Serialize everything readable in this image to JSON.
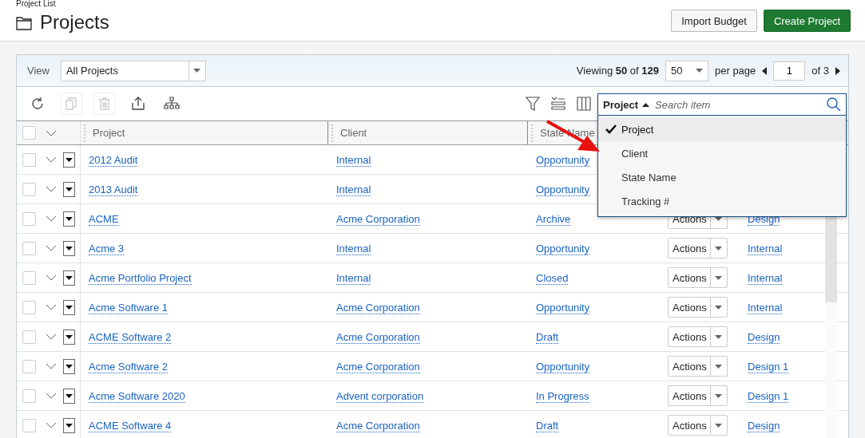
{
  "breadcrumb": "Project List",
  "title": "Projects",
  "header_buttons": [
    {
      "label": "Import Budget",
      "kind": "secondary"
    },
    {
      "label": "Create Project",
      "kind": "primary"
    }
  ],
  "view": {
    "label": "View",
    "value": "All Projects"
  },
  "pagination": {
    "summary": "Viewing **50** of **129**",
    "per_page": "50",
    "per_page_label": "per page",
    "page": "1",
    "of_pages": "of 3"
  },
  "toolbar": [
    {
      "kind": "refresh",
      "disabled": false
    },
    {
      "kind": "copy",
      "disabled": true
    },
    {
      "kind": "delete",
      "disabled": true
    },
    {
      "kind": "export",
      "disabled": false
    },
    {
      "kind": "hierarchy",
      "disabled": false
    }
  ],
  "search": {
    "field": "Project",
    "placeholder": "Search item",
    "options": [
      {
        "label": "Project",
        "selected": true
      },
      {
        "label": "Client",
        "selected": false
      },
      {
        "label": "State Name",
        "selected": false
      },
      {
        "label": "Tracking #",
        "selected": false
      }
    ]
  },
  "table": {
    "select_all_checked": false,
    "columns": [
      "Project",
      "Client",
      "State Name"
    ],
    "rows": [
      {
        "checked": false,
        "project": "2012 Audit",
        "client": "Internal",
        "state": "Opportunity"
      },
      {
        "checked": false,
        "project": "2013 Audit",
        "client": "Internal",
        "state": "Opportunity"
      },
      {
        "checked": false,
        "project": "ACME",
        "client": "Acme Corporation",
        "state": "Archive",
        "actions": "Actions",
        "column_5": "Design"
      },
      {
        "checked": false,
        "project": "Acme 3",
        "client": "Internal",
        "state": "Opportunity",
        "actions": "Actions",
        "column_5": "Internal"
      },
      {
        "checked": false,
        "project": "Acme Portfolio Project",
        "client": "Internal",
        "state": "Closed",
        "actions": "Actions",
        "column_5": "Internal"
      },
      {
        "checked": false,
        "project": "Acme Software 1",
        "client": "Acme Corporation",
        "state": "Opportunity",
        "actions": "Actions",
        "column_5": "Internal"
      },
      {
        "checked": false,
        "project": "ACME Software 2",
        "client": "Acme Corporation",
        "state": "Draft",
        "actions": "Actions",
        "column_5": "Design"
      },
      {
        "checked": false,
        "project": "Acme Software 2",
        "client": "Acme Corporation",
        "state": "Opportunity",
        "actions": "Actions",
        "column_5": "Design 1"
      },
      {
        "checked": false,
        "project": "Acme Software 2020",
        "client": "Advent corporation",
        "state": "In Progress",
        "actions": "Actions",
        "column_5": "Design 1"
      },
      {
        "checked": false,
        "project": "ACME Software 4",
        "client": "Acme Corporation",
        "state": "Draft",
        "actions": "Actions",
        "column_5": "Design"
      }
    ]
  }
}
